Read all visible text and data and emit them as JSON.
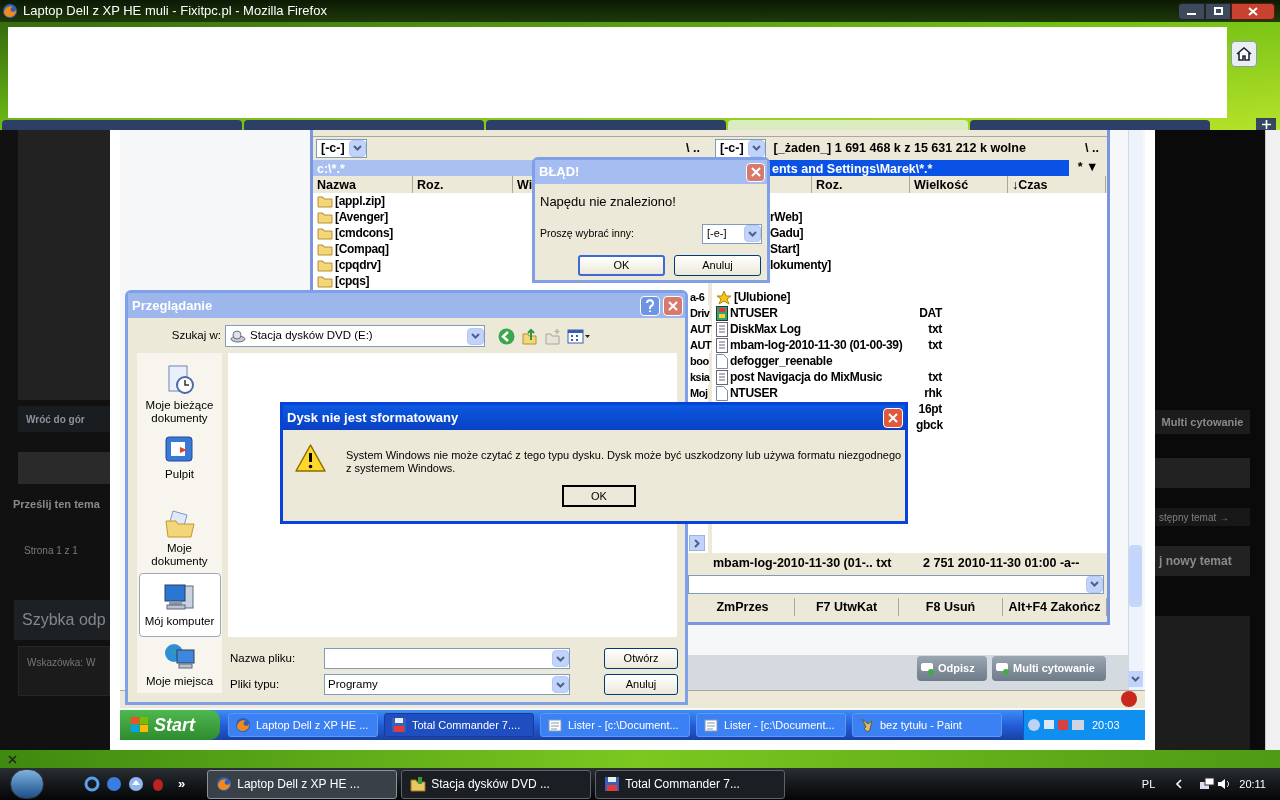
{
  "browser": {
    "title": "Laptop Dell z XP HE muli - Fixitpc.pl - Mozilla Firefox"
  },
  "forum_left": [
    "Wróć do gór",
    "Prześlij ten tema",
    "Strona 1 z 1",
    "Szybka odp",
    "Wskazówka: W"
  ],
  "forum_right": [
    "Multi cytowanie",
    "stępny temat →",
    "j nowy temat"
  ],
  "total_commander": {
    "left": {
      "active": false,
      "drive": "[-c-]",
      "nav": "\\ ..",
      "path": "c:\\*.*",
      "columns": [
        "Nazwa",
        "Roz.",
        "Wi"
      ],
      "rows": [
        {
          "kind": "folder",
          "name": "[appl.zip]"
        },
        {
          "kind": "folder",
          "name": "[Avenger]"
        },
        {
          "kind": "folder",
          "name": "[cmdcons]"
        },
        {
          "kind": "folder",
          "name": "[Compaq]"
        },
        {
          "kind": "folder",
          "name": "[cpqdrv]"
        },
        {
          "kind": "folder",
          "name": "[cpqs]"
        },
        {
          "kind": "tail",
          "tail": "a-6"
        },
        {
          "kind": "tail",
          "tail": "Driv"
        },
        {
          "kind": "tail",
          "tail": "AUT"
        },
        {
          "kind": "tail",
          "tail": "AUT"
        },
        {
          "kind": "tail",
          "tail": "boo"
        },
        {
          "kind": "tail",
          "tail": "ksia"
        },
        {
          "kind": "tail",
          "tail": "Moj"
        }
      ]
    },
    "right": {
      "active": true,
      "drive": "[-c-]",
      "free": "[_żaden_]  1 691 468 k z 15 631 212 k wolne",
      "nav": "\\ ..",
      "path": "ents and Settings\\Marek\\*.*",
      "filter": "* ▼",
      "columns": [
        "Roz.",
        "Wielkość",
        "↓Czas"
      ],
      "rows": [
        {
          "kind": "cut",
          "name": "rWeb]"
        },
        {
          "kind": "cut",
          "name": "Gadu]"
        },
        {
          "kind": "cut",
          "name": "Start]"
        },
        {
          "kind": "cut",
          "name": "lokumenty]"
        },
        {
          "kind": "favorites",
          "name": "[Ulubione]"
        },
        {
          "kind": "media",
          "name": "NTUSER",
          "ext": "DAT"
        },
        {
          "kind": "text",
          "name": "DiskMax Log",
          "ext": "txt"
        },
        {
          "kind": "text",
          "name": "mbam-log-2010-11-30 (01-00-39)",
          "ext": "txt"
        },
        {
          "kind": "file",
          "name": "defogger_reenable"
        },
        {
          "kind": "text",
          "name": "post Navigacja do MixMusic",
          "ext": "txt"
        },
        {
          "kind": "file",
          "name": "NTUSER",
          "ext": "rhk"
        },
        {
          "kind": "ext_only",
          "ext": "16pt"
        },
        {
          "kind": "ext_only",
          "ext": "gbck"
        }
      ]
    },
    "status_name": "mbam-log-2010-11-30 (01-.. txt",
    "status_info": "2 751  2010-11-30 01:00 -a--",
    "function_keys": [
      "ZmPrzes",
      "F7 UtwKat",
      "F8 Usuń",
      "Alt+F4 Zakończ"
    ]
  },
  "error_dialog": {
    "title": "BŁĄD!",
    "message": "Napędu nie znaleziono!",
    "label": "Proszę wybrać inny:",
    "drive": "[-e-]",
    "buttons": [
      "OK",
      "Anuluj"
    ]
  },
  "open_dialog": {
    "title": "Przeglądanie",
    "look_in_label": "Szukaj w:",
    "look_in": "Stacja dysków DVD (E:)",
    "places": [
      {
        "kind": "recent",
        "label": "Moje bieżące dokumenty",
        "selected": false
      },
      {
        "kind": "desktop",
        "label": "Pulpit",
        "selected": false
      },
      {
        "kind": "documents",
        "label": "Moje dokumenty",
        "selected": false
      },
      {
        "kind": "computer",
        "label": "Mój komputer",
        "selected": true
      },
      {
        "kind": "network",
        "label": "Moje miejsca",
        "selected": false
      }
    ],
    "file_name_label": "Nazwa pliku:",
    "file_type_label": "Pliki typu:",
    "file_type": "Programy",
    "buttons": [
      "Otwórz",
      "Anuluj"
    ]
  },
  "format_dialog": {
    "title": "Dysk nie jest sformatowany",
    "message": "System Windows nie może czytać z tego typu dysku. Dysk może być uszkodzony lub używa formatu niezgodnego z systemem Windows.",
    "button": "OK"
  },
  "forum_buttons": [
    "Odpisz",
    "Multi cytowanie"
  ],
  "browser_tabs": [
    {
      "selected": false
    },
    {
      "selected": false
    },
    {
      "selected": false
    },
    {
      "selected": true
    },
    {
      "selected": false
    }
  ],
  "xp_taskbar": {
    "start": "Start",
    "clock": "20:03",
    "items": [
      {
        "kind": "firefox",
        "label": "Laptop Dell z XP HE ...",
        "selected": false
      },
      {
        "kind": "floppy",
        "label": "Total Commander 7....",
        "selected": true
      },
      {
        "kind": "document",
        "label": "Lister - [c:\\Document...",
        "selected": false
      },
      {
        "kind": "document",
        "label": "Lister - [c:\\Document...",
        "selected": false
      },
      {
        "kind": "paint",
        "label": "bez tytułu - Paint",
        "selected": false
      }
    ]
  },
  "vista_taskbar": {
    "more": "»",
    "language": "PL",
    "clock": "20:11",
    "items": [
      {
        "kind": "firefox",
        "label": "Laptop Dell z XP HE ...",
        "selected": true
      },
      {
        "kind": "drive",
        "label": "Stacja dysków DVD ...",
        "selected": false
      },
      {
        "kind": "floppy",
        "label": "Total Commander 7...",
        "selected": false
      }
    ]
  }
}
